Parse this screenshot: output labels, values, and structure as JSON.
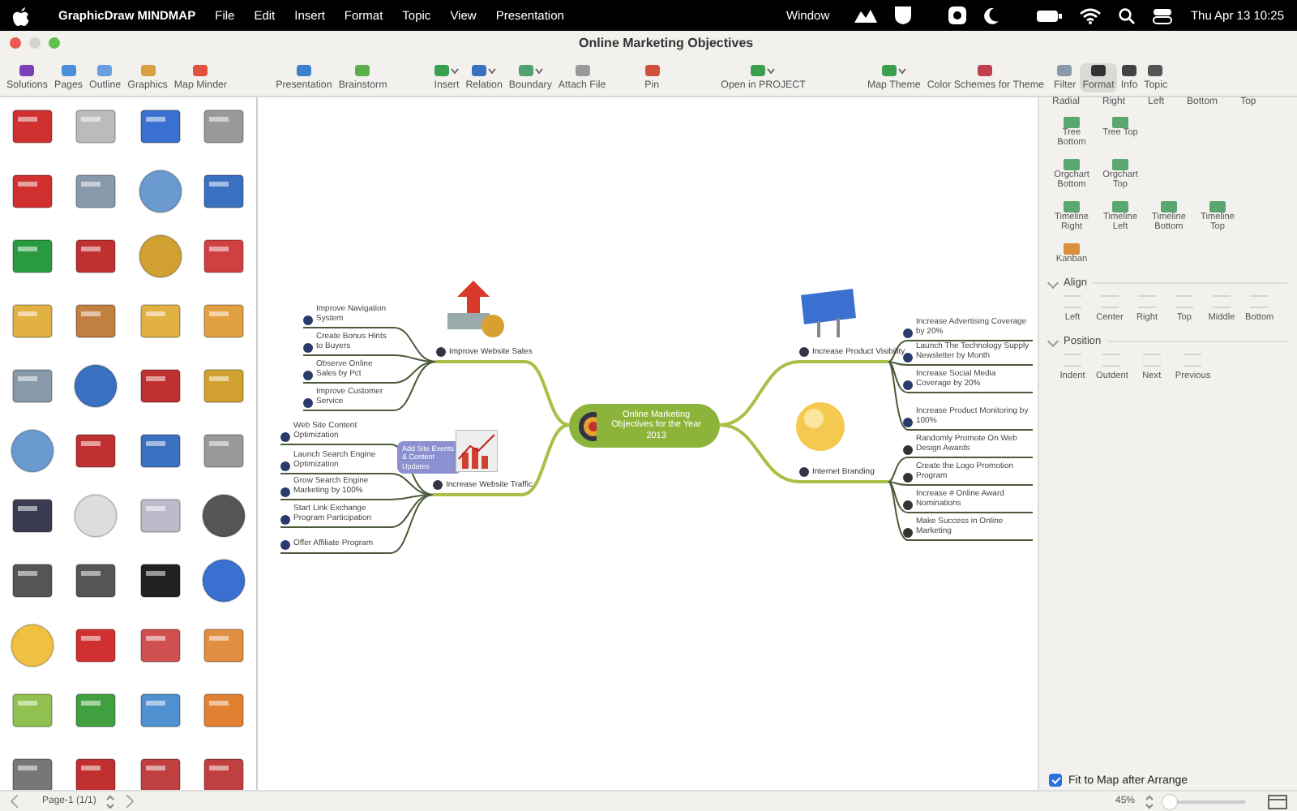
{
  "menu_bar": {
    "app_name": "GraphicDraw MINDMAP",
    "items": [
      "File",
      "Edit",
      "Insert",
      "Format",
      "Topic",
      "View",
      "Presentation",
      "Window"
    ],
    "clock": "Thu Apr 13  10:25"
  },
  "window": {
    "title": "Online Marketing Objectives"
  },
  "toolbar": [
    {
      "label": "Solutions",
      "dropdown": false,
      "selected": false
    },
    {
      "label": "Pages",
      "dropdown": false,
      "selected": false
    },
    {
      "label": "Outline",
      "dropdown": false,
      "selected": false
    },
    {
      "label": "Graphics",
      "dropdown": false,
      "selected": false
    },
    {
      "label": "Map Minder",
      "dropdown": false,
      "selected": false
    },
    {
      "label": "Presentation",
      "dropdown": false,
      "selected": false
    },
    {
      "label": "Brainstorm",
      "dropdown": false,
      "selected": false
    },
    {
      "label": "Insert",
      "dropdown": true,
      "selected": false
    },
    {
      "label": "Relation",
      "dropdown": true,
      "selected": false
    },
    {
      "label": "Boundary",
      "dropdown": true,
      "selected": false
    },
    {
      "label": "Attach File",
      "dropdown": false,
      "selected": false
    },
    {
      "label": "Pin",
      "dropdown": false,
      "selected": false
    },
    {
      "label": "Open in PROJECT",
      "dropdown": true,
      "selected": false
    },
    {
      "label": "Map Theme",
      "dropdown": true,
      "selected": false
    },
    {
      "label": "Color Schemes for Theme",
      "dropdown": false,
      "selected": false
    },
    {
      "label": "Filter",
      "dropdown": false,
      "selected": false
    },
    {
      "label": "Format",
      "dropdown": false,
      "selected": true
    },
    {
      "label": "Info",
      "dropdown": false,
      "selected": false
    },
    {
      "label": "Topic",
      "dropdown": false,
      "selected": false
    }
  ],
  "mind_map": {
    "central": "Online Marketing Objectives for the Year 2013",
    "branches": [
      {
        "label": "Improve Website Sales",
        "children": [
          "Improve Navigation System",
          "Create Bonus Hints to Buyers",
          "Observe Online Sales by Pct",
          "Improve Customer Service"
        ]
      },
      {
        "label": "Increase Website Traffic",
        "callout": "Add Site Events & Content Updates",
        "children": [
          "Web Site Content Optimization",
          "Launch Search Engine Optimization",
          "Grow Search Engine Marketing by 100%",
          "Start Link Exchange Program Participation",
          "Offer Affiliate Program"
        ]
      },
      {
        "label": "Increase Product Visibility",
        "children": [
          "Increase Advertising Coverage by 20%",
          "Launch The Technology Supply Newsletter by Month",
          "Increase Social Media Coverage by 20%",
          "Increase Product Monitoring by 100%"
        ]
      },
      {
        "label": "Internet Branding",
        "children": [
          "Randomly Promote On Web Design Awards",
          "Create the Logo Promotion Program",
          "Increase # Online Award Nominations",
          "Make Success in Online Marketing"
        ]
      }
    ]
  },
  "layout_panel": {
    "top_row": [
      "Radial",
      "Right",
      "Left",
      "Bottom",
      "Top"
    ],
    "layouts": [
      [
        "Tree Bottom",
        "Tree Top"
      ],
      [
        "Orgchart Bottom",
        "Orgchart Top"
      ],
      [
        "Timeline Right",
        "Timeline Left",
        "Timeline Bottom",
        "Timeline Top"
      ],
      [
        "Kanban"
      ]
    ],
    "sections": [
      {
        "title": "Align",
        "expanded": true,
        "items": [
          "Left",
          "Center",
          "Right",
          "Top",
          "Middle",
          "Bottom"
        ]
      },
      {
        "title": "Position",
        "expanded": true,
        "items": [
          "Indent",
          "Outdent",
          "Next",
          "Previous"
        ]
      }
    ],
    "fit_to_map": {
      "label": "Fit to Map after Arrange",
      "checked": true
    }
  },
  "status_bar": {
    "page": "Page-1 (1/1)",
    "zoom": "45%",
    "zoom_slider": {
      "level": 0.07
    }
  }
}
